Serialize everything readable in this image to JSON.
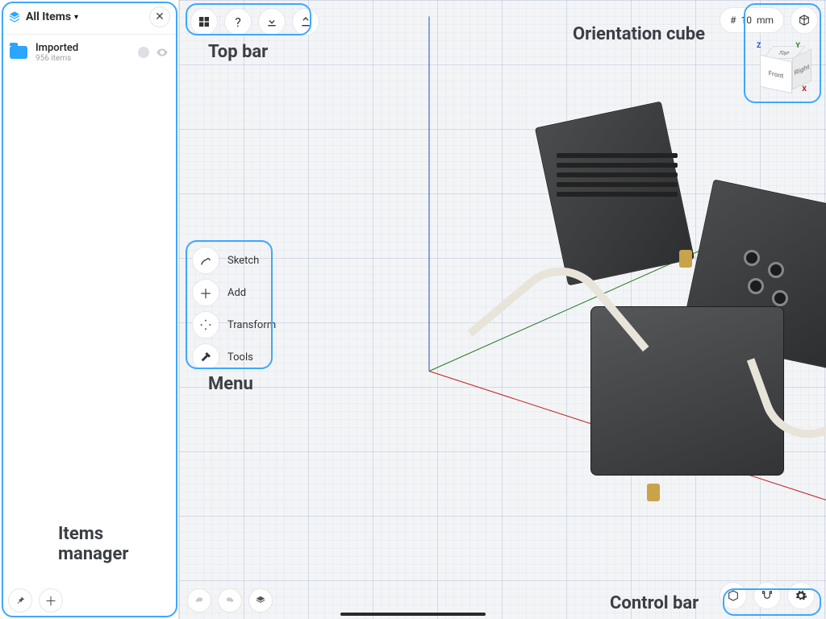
{
  "sidebar": {
    "title": "All Items",
    "item": {
      "name": "Imported",
      "count": "956 items"
    }
  },
  "topbar": {
    "grid": "grid-icon",
    "help": "?",
    "import": "import-icon",
    "export": "export-icon"
  },
  "menu": {
    "items": [
      {
        "label": "Sketch"
      },
      {
        "label": "Add"
      },
      {
        "label": "Transform"
      },
      {
        "label": "Tools"
      }
    ]
  },
  "units": {
    "value": "10",
    "unit": "mm"
  },
  "orientation": {
    "top": "Top",
    "front": "Front",
    "right": "Right"
  },
  "annotations": {
    "topbar": "Top bar",
    "orientation": "Orientation cube",
    "menu": "Menu",
    "items": "Items\nmanager",
    "control": "Control bar"
  }
}
